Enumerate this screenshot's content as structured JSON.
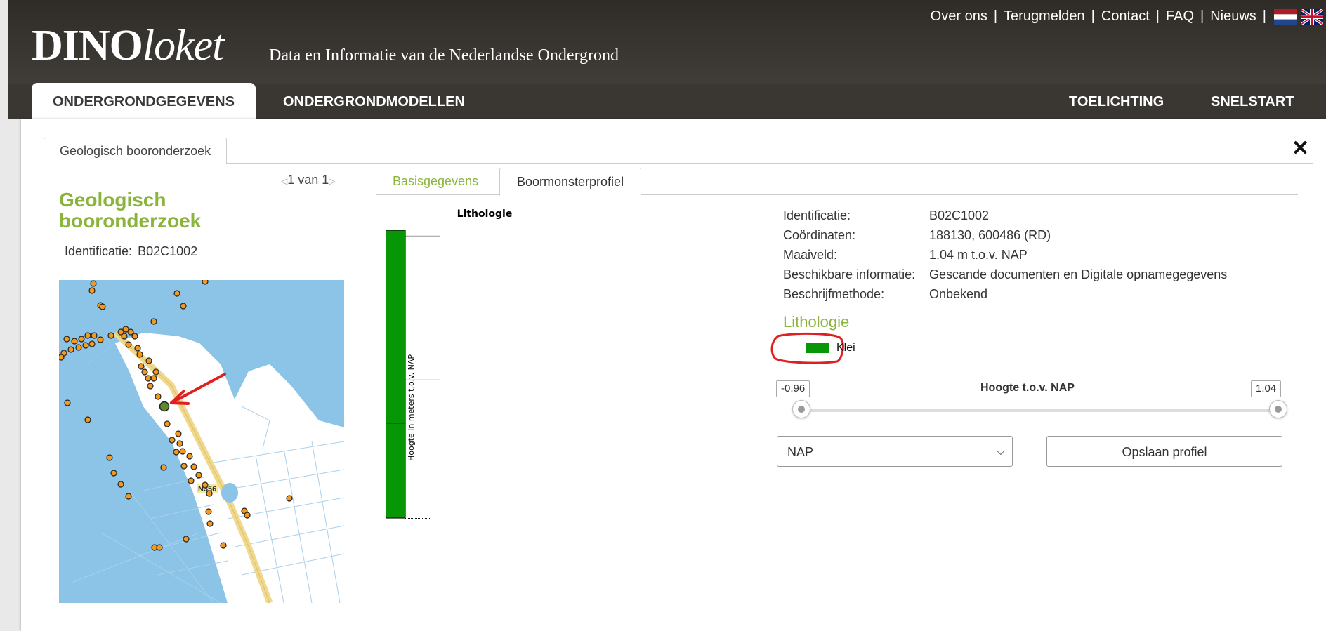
{
  "header": {
    "logo_bold": "DINO",
    "logo_italic": "loket",
    "tagline": "Data en Informatie van de Nederlandse Ondergrond",
    "links": [
      "Over ons",
      "Terugmelden",
      "Contact",
      "FAQ",
      "Nieuws"
    ],
    "language_flags": [
      "dutch-flag-icon",
      "uk-flag-icon"
    ]
  },
  "nav": {
    "tabs": [
      "ONDERGRONDGEGEVENS",
      "ONDERGRONDMODELLEN"
    ],
    "right_tabs": [
      "TOELICHTING",
      "SNELSTART"
    ],
    "active_tab": "ONDERGRONDGEGEVENS"
  },
  "panel": {
    "tab_label": "Geologisch booronderzoek",
    "close_icon": "close-icon",
    "pager": "1 van 1",
    "title": "Geologisch booronderzoek",
    "id_label": "Identificatie:",
    "id_value": "B02C1002"
  },
  "subtabs": {
    "basis": "Basisgegevens",
    "profiel": "Boormonsterprofiel",
    "active": "Boormonsterprofiel"
  },
  "chart_data": {
    "type": "bar",
    "title": "Lithologie",
    "ylabel": "Hoogte in meters t.o.v. NAP",
    "y_ticks": [
      1,
      0
    ],
    "ylim": [
      -0.96,
      1.04
    ],
    "segments": [
      {
        "name": "Klei",
        "top": 1.04,
        "bottom": -0.3,
        "color": "#069606"
      },
      {
        "name": "Klei",
        "top": -0.3,
        "bottom": -0.96,
        "color": "#069606"
      }
    ]
  },
  "info": {
    "rows": [
      {
        "label": "Identificatie:",
        "value": "B02C1002"
      },
      {
        "label": "Coördinaten:",
        "value": "188130, 600486 (RD)"
      },
      {
        "label": "Maaiveld:",
        "value": "1.04 m t.o.v. NAP"
      },
      {
        "label": "Beschikbare informatie:",
        "value": "Gescande documenten en Digitale opnamegegevens"
      },
      {
        "label": "Beschrijfmethode:",
        "value": "Onbekend"
      }
    ],
    "litho_heading": "Lithologie",
    "legend": [
      {
        "label": "Klei",
        "color": "#069606"
      }
    ]
  },
  "slider": {
    "label": "Hoogte t.o.v. NAP",
    "min_value": "-0.96",
    "max_value": "1.04"
  },
  "controls": {
    "reference_select": "NAP",
    "save_button": "Opslaan profiel"
  },
  "map": {
    "road_label": "N356"
  },
  "colors": {
    "accent_green": "#8ab43c",
    "clay_green": "#069606",
    "header_dark": "#3a3733"
  }
}
